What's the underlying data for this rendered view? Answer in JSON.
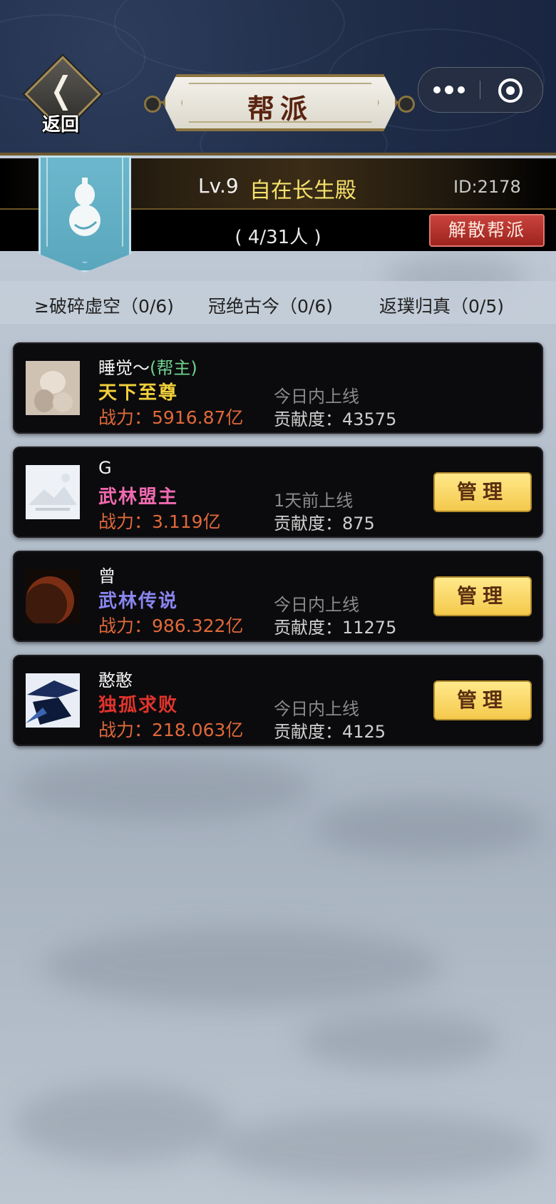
{
  "header": {
    "back_label": "返回",
    "title": "帮派",
    "capsule": {
      "more_icon": "more-dots-icon",
      "close_icon": "target-close-icon"
    }
  },
  "guild": {
    "level": "Lv.9",
    "name": "自在长生殿",
    "id": "ID:2178",
    "members": "( 4/31人 )",
    "disband_label": "解散帮派",
    "emblem_icon": "gourd-icon",
    "colors": {
      "name": "#f6e16b",
      "disband": "#b32f28",
      "banner": "#6cb7cc"
    }
  },
  "realms": [
    "≥破碎虚空（0/6)",
    "冠绝古今（0/6)",
    "返璞归真（0/5)"
  ],
  "members": [
    {
      "name": "睡觉～",
      "role": "(帮主)",
      "title": "天下至尊",
      "title_color": "#f2d03b",
      "power": "战力：5916.87亿",
      "online": "今日内上线",
      "contribution": "贡献度：43575",
      "has_manage": false
    },
    {
      "name": "G",
      "role": "",
      "title": "武林盟主",
      "title_color": "#f06ab0",
      "power": "战力：3.119亿",
      "online": "1天前上线",
      "contribution": "贡献度：875",
      "has_manage": true,
      "manage_label": "管理"
    },
    {
      "name": "曾",
      "role": "",
      "title": "武林传说",
      "title_color": "#8a86f0",
      "power": "战力：986.322亿",
      "online": "今日内上线",
      "contribution": "贡献度：11275",
      "has_manage": true,
      "manage_label": "管理"
    },
    {
      "name": "憨憨",
      "role": "",
      "title": "独孤求败",
      "title_color": "#e0342c",
      "power": "战力：218.063亿",
      "online": "今日内上线",
      "contribution": "贡献度：4125",
      "has_manage": true,
      "manage_label": "管理"
    }
  ]
}
